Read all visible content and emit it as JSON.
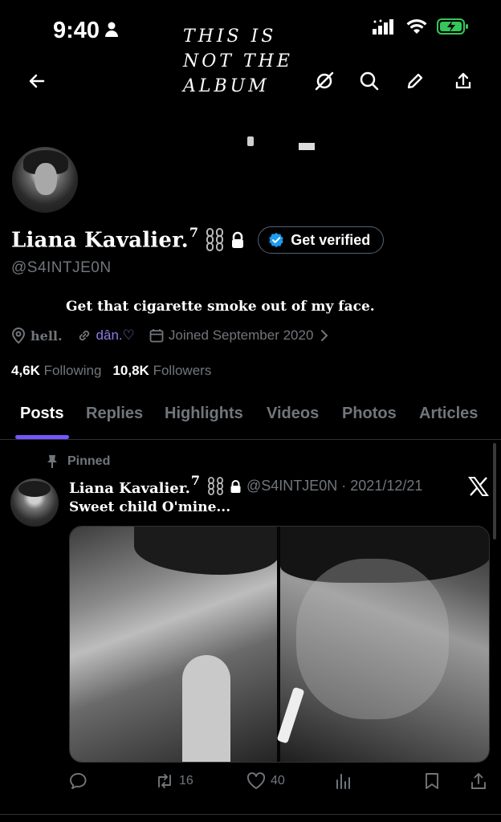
{
  "status_bar": {
    "time": "9:40"
  },
  "banner": {
    "line1": "THIS IS",
    "line2": "NOT THE",
    "line3": "ALBUM"
  },
  "profile": {
    "display_name": "Liana Kavalier.",
    "name_superscript": "7",
    "handle": "@S4INTJE0N",
    "verify_label": "Get verified",
    "bio": "Get that cigarette smoke out of my face.",
    "location": "hell.",
    "link": "dân.♡",
    "joined": "Joined September 2020",
    "following_count": "4,6K",
    "following_label": "Following",
    "followers_count": "10,8K",
    "followers_label": "Followers"
  },
  "tabs": [
    "Posts",
    "Replies",
    "Highlights",
    "Videos",
    "Photos",
    "Articles"
  ],
  "active_tab": "Posts",
  "post": {
    "pinned_label": "Pinned",
    "author_name": "Liana Kavalier.",
    "author_superscript": "7",
    "meta": "@S4INTJE0N · 2021/12/21",
    "text": "Sweet child O'mine...",
    "reposts": "16",
    "likes": "40"
  },
  "colors": {
    "accent": "#7856ff",
    "verify_badge": "#1d9bf0",
    "muted": "#71767b",
    "battery": "#34c759"
  }
}
